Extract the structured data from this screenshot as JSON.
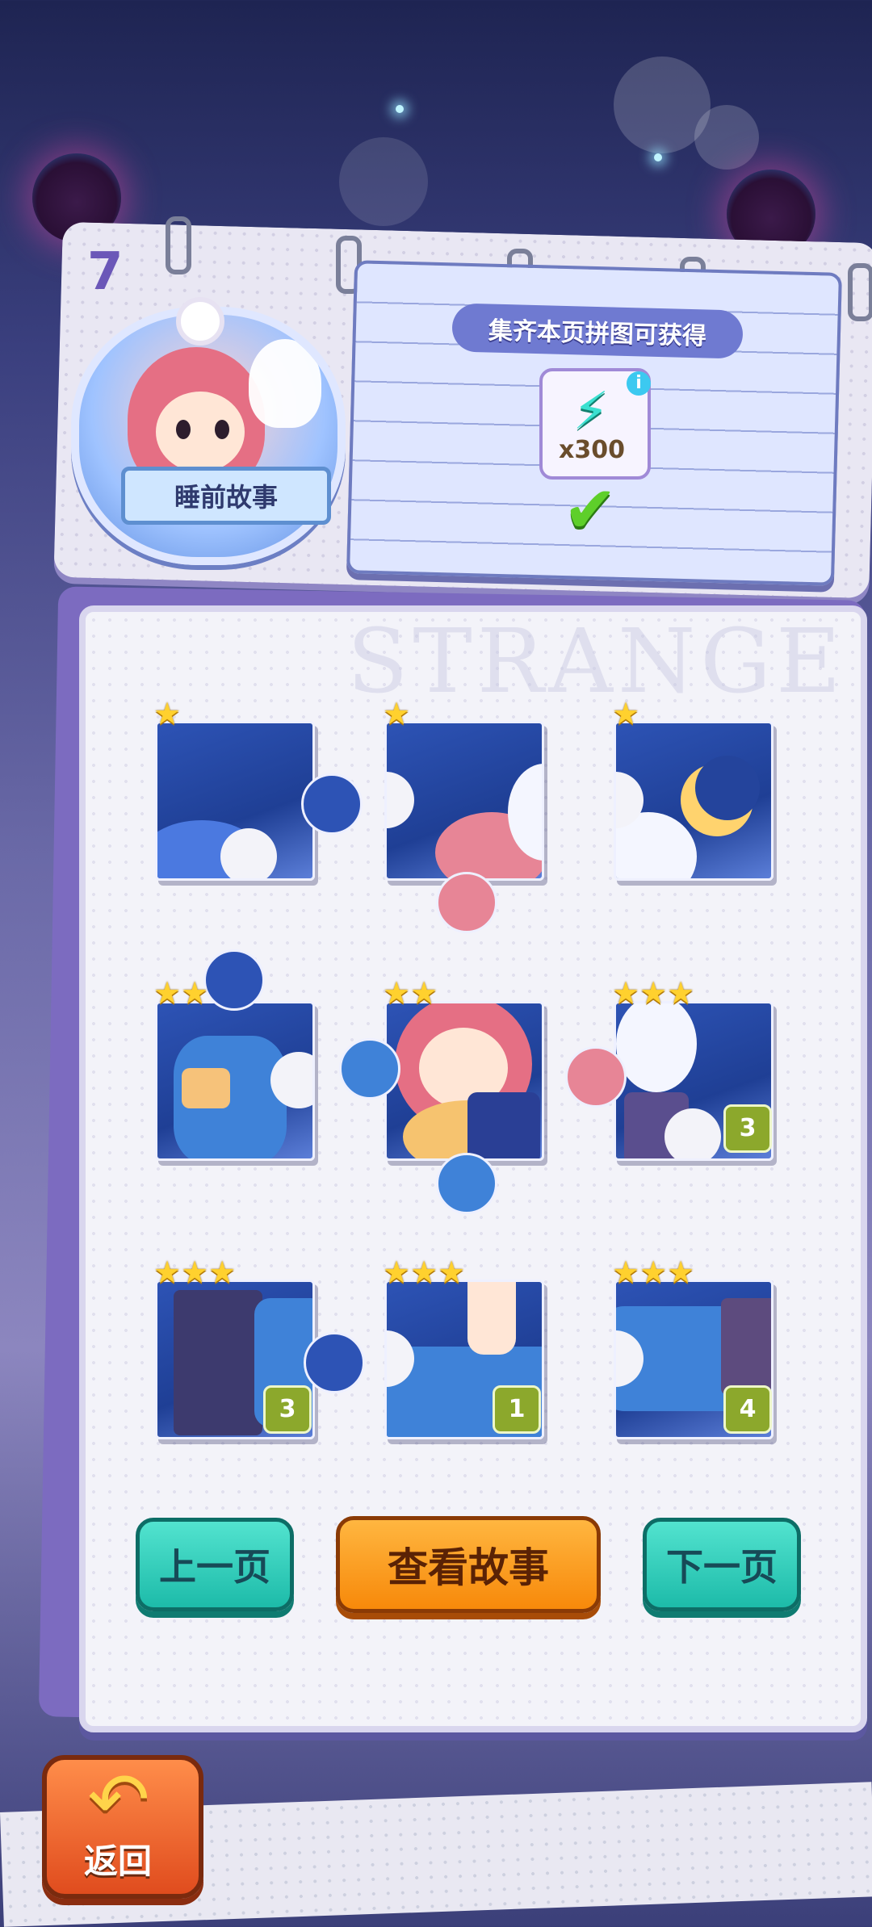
{
  "chapter": {
    "number": "7",
    "title": "睡前故事"
  },
  "reward": {
    "title": "集齐本页拼图可获得",
    "item_icon": "lightning-bolt-icon",
    "item_count": "x300",
    "info_icon": "info-icon",
    "claimed": true
  },
  "watermark": "STRANGE",
  "pieces": [
    {
      "stars": "★",
      "count": ""
    },
    {
      "stars": "★",
      "count": ""
    },
    {
      "stars": "★",
      "count": ""
    },
    {
      "stars": "★★",
      "count": ""
    },
    {
      "stars": "★★",
      "count": ""
    },
    {
      "stars": "★★★",
      "count": "3"
    },
    {
      "stars": "★★★",
      "count": "3"
    },
    {
      "stars": "★★★",
      "count": "1"
    },
    {
      "stars": "★★★",
      "count": "4"
    }
  ],
  "buttons": {
    "prev": "上一页",
    "story": "查看故事",
    "next": "下一页",
    "back": "返回"
  },
  "colors": {
    "star": "#ffd12e",
    "green_button": "#1dbba9",
    "orange_button": "#f7890a",
    "count_badge": "#8ca82c"
  }
}
